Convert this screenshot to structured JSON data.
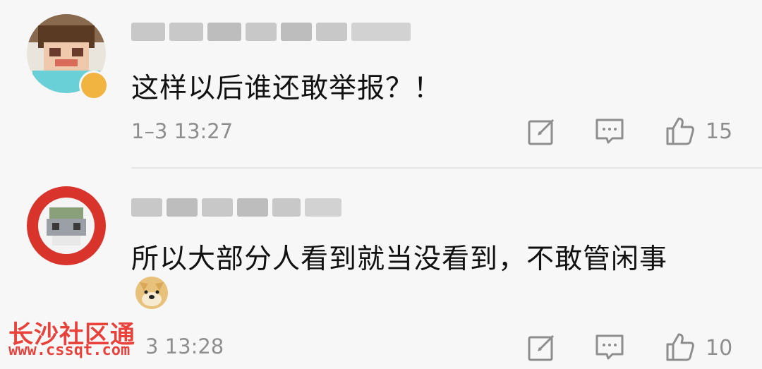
{
  "comments": [
    {
      "text": "这样以后谁还敢举报？！",
      "time": "1–3 13:27",
      "likes": "15",
      "avatar_icon": "pixelated-avatar",
      "badge_icon": "verified-badge-icon"
    },
    {
      "text": "所以大部分人看到就当没看到，不敢管闲事",
      "time": "3 13:28",
      "likes": "10",
      "avatar_icon": "pixelated-avatar",
      "emoji_icon": "doge-emoji-icon"
    }
  ],
  "watermark": {
    "title": "长沙社区通",
    "url": "www.cssqt.com"
  },
  "icons": {
    "edit": "edit-square-icon",
    "comment": "comment-bubble-icon",
    "like": "thumbs-up-icon"
  },
  "colors": {
    "background": "#f7f7f7",
    "text": "#111111",
    "meta": "#8e8e8e",
    "watermark": "#e8423b"
  }
}
